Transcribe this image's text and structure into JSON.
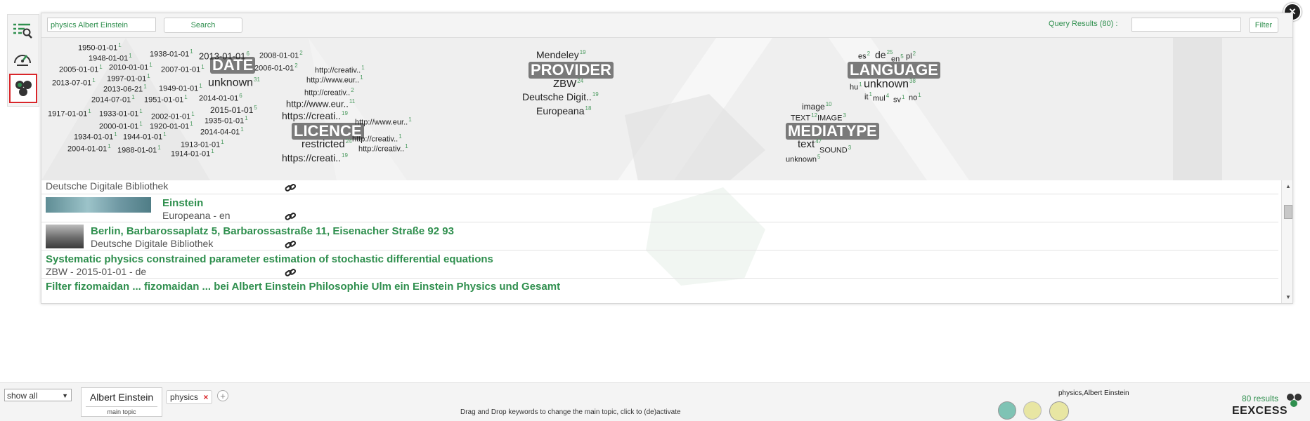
{
  "close_label": "✕",
  "toolbar": {
    "query_value": "physics Albert Einstein",
    "search_label": "Search",
    "results_label": "Query Results (80) :",
    "filter_value": "",
    "filter_label": "Filter"
  },
  "facets": {
    "date": {
      "name": "DATE",
      "tags": [
        {
          "t": "1950-01-01",
          "c": "1"
        },
        {
          "t": "1948-01-01",
          "c": "1"
        },
        {
          "t": "1938-01-01",
          "c": "1"
        },
        {
          "t": "2013-01-01",
          "c": "6"
        },
        {
          "t": "2008-01-01",
          "c": "2"
        },
        {
          "t": "2005-01-01",
          "c": "1"
        },
        {
          "t": "2010-01-01",
          "c": "1"
        },
        {
          "t": "2007-01-01",
          "c": "1"
        },
        {
          "t": "2006-01-01",
          "c": "2"
        },
        {
          "t": "2013-07-01",
          "c": "1"
        },
        {
          "t": "1997-01-01",
          "c": "1"
        },
        {
          "t": "unknown",
          "c": "31"
        },
        {
          "t": "2013-06-21",
          "c": "1"
        },
        {
          "t": "1949-01-01",
          "c": "1"
        },
        {
          "t": "2014-07-01",
          "c": "1"
        },
        {
          "t": "1951-01-01",
          "c": "1"
        },
        {
          "t": "2014-01-01",
          "c": "6"
        },
        {
          "t": "1917-01-01",
          "c": "1"
        },
        {
          "t": "1933-01-01",
          "c": "1"
        },
        {
          "t": "2002-01-01",
          "c": "1"
        },
        {
          "t": "2015-01-01",
          "c": "5"
        },
        {
          "t": "1935-01-01",
          "c": "1"
        },
        {
          "t": "2000-01-01",
          "c": "1"
        },
        {
          "t": "1920-01-01",
          "c": "1"
        },
        {
          "t": "1934-01-01",
          "c": "1"
        },
        {
          "t": "1944-01-01",
          "c": "1"
        },
        {
          "t": "2014-04-01",
          "c": "1"
        },
        {
          "t": "2004-01-01",
          "c": "1"
        },
        {
          "t": "1988-01-01",
          "c": "1"
        },
        {
          "t": "1913-01-01",
          "c": "1"
        },
        {
          "t": "1914-01-01",
          "c": "1"
        }
      ]
    },
    "licence": {
      "name": "LICENCE",
      "tags": [
        {
          "t": "http://creativ..",
          "c": "1"
        },
        {
          "t": "http://www.eur..",
          "c": "1"
        },
        {
          "t": "http://creativ..",
          "c": "2"
        },
        {
          "t": "http://www.eur..",
          "c": "11"
        },
        {
          "t": "https://creati..",
          "c": "19"
        },
        {
          "t": "http://www.eur..",
          "c": "1"
        },
        {
          "t": "http://creativ..",
          "c": "1"
        },
        {
          "t": "restricted",
          "c": "24"
        },
        {
          "t": "http://creativ..",
          "c": "1"
        },
        {
          "t": "https://creati..",
          "c": "19"
        }
      ]
    },
    "provider": {
      "name": "PROVIDER",
      "tags": [
        {
          "t": "Mendeley",
          "c": "19"
        },
        {
          "t": "ZBW",
          "c": "24"
        },
        {
          "t": "Deutsche Digit..",
          "c": "19"
        },
        {
          "t": "Europeana",
          "c": "18"
        }
      ]
    },
    "mediatype": {
      "name": "MEDIATYPE",
      "tags": [
        {
          "t": "image",
          "c": "10"
        },
        {
          "t": "TEXT",
          "c": "12"
        },
        {
          "t": "IMAGE",
          "c": "3"
        },
        {
          "t": "text",
          "c": "47"
        },
        {
          "t": "SOUND",
          "c": "3"
        },
        {
          "t": "unknown",
          "c": "5"
        }
      ]
    },
    "language": {
      "name": "LANGUAGE",
      "tags": [
        {
          "t": "es",
          "c": "2"
        },
        {
          "t": "de",
          "c": "25"
        },
        {
          "t": "en",
          "c": "5"
        },
        {
          "t": "pl",
          "c": "2"
        },
        {
          "t": "hu",
          "c": "1"
        },
        {
          "t": "unknown",
          "c": "38"
        },
        {
          "t": "it",
          "c": "1"
        },
        {
          "t": "mul",
          "c": "4"
        },
        {
          "t": "sv",
          "c": "1"
        },
        {
          "t": "no",
          "c": "1"
        }
      ]
    }
  },
  "results": [
    {
      "title": "",
      "meta": "Deutsche Digitale Bibliothek"
    },
    {
      "title": "Einstein",
      "meta": "Europeana - en"
    },
    {
      "title": "Berlin, Barbarossaplatz 5, Barbarossastraße 11, Eisenacher Straße 92 93",
      "meta": "Deutsche Digitale Bibliothek"
    },
    {
      "title": "Systematic physics constrained parameter estimation of stochastic differential equations",
      "meta": "ZBW - 2015-01-01 - de"
    },
    {
      "title": "Filter fizomaidan ... fizomaidan ... bei Albert Einstein Philosophie Ulm ein Einstein Physics und Gesamt",
      "meta": ""
    }
  ],
  "bottom": {
    "show_select": "show all",
    "main_topic": "Albert Einstein",
    "main_topic_caption": "main topic",
    "keyword": "physics",
    "keyword_remove": "×",
    "hint": "Drag and Drop keywords to change the main topic, click to (de)activate",
    "history_label": "physics,Albert Einstein",
    "results_count": "80 results",
    "brand": "EEXCESS"
  },
  "colors": {
    "accent": "#2f8f4e",
    "highlight": "#d9262a",
    "facet_label": "#7a7a7a",
    "dot_teal": "#7fc3b4",
    "dot_yellow": "#e8e6a3"
  },
  "icons": {
    "sidebar": [
      "list-search-icon",
      "dashboard-gauge-icon",
      "hexagon-cluster-icon"
    ],
    "link": "link-chain-icon",
    "close": "close-icon"
  }
}
